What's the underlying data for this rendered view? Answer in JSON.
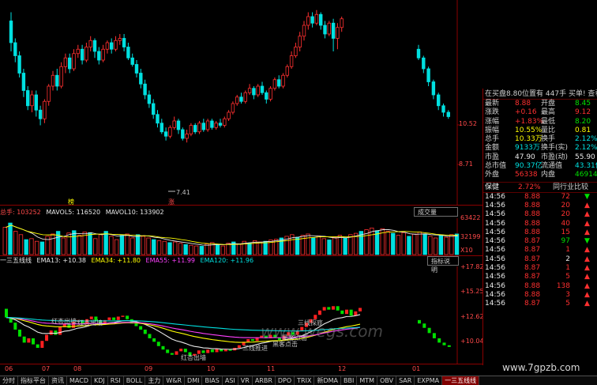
{
  "price_panel": {
    "y_labels": [
      "10.52",
      "8.71"
    ],
    "annotations": [
      {
        "text": "榜",
        "color": "#ffff00"
      },
      {
        "text": "7.41",
        "color": "#c0c0c0"
      },
      {
        "text": "涨",
        "color": "#ff4a4a"
      }
    ],
    "candles": [
      [
        13.0,
        12.0,
        13.4,
        11.6
      ],
      [
        12.0,
        11.4,
        12.2,
        11.1
      ],
      [
        11.4,
        10.6,
        11.6,
        10.4
      ],
      [
        10.6,
        9.8,
        10.8,
        9.5
      ],
      [
        9.8,
        9.1,
        10.0,
        8.9
      ],
      [
        9.1,
        9.6,
        9.8,
        8.8
      ],
      [
        9.6,
        8.9,
        9.8,
        8.6
      ],
      [
        8.9,
        8.5,
        9.1,
        8.2
      ],
      [
        8.5,
        9.3,
        9.4,
        8.3
      ],
      [
        9.3,
        10.0,
        10.1,
        9.1
      ],
      [
        10.0,
        10.5,
        10.7,
        9.8
      ],
      [
        10.5,
        10.0,
        10.8,
        9.8
      ],
      [
        10.0,
        10.9,
        11.1,
        9.9
      ],
      [
        10.9,
        11.3,
        11.5,
        10.6
      ],
      [
        11.3,
        10.8,
        11.5,
        10.6
      ],
      [
        10.8,
        11.5,
        11.7,
        10.7
      ],
      [
        11.5,
        11.7,
        11.9,
        11.3
      ],
      [
        11.7,
        11.2,
        11.9,
        11.0
      ],
      [
        11.2,
        11.8,
        12.0,
        11.1
      ],
      [
        11.8,
        12.1,
        12.3,
        11.6
      ],
      [
        12.1,
        11.6,
        12.2,
        11.3
      ],
      [
        11.6,
        11.2,
        11.8,
        11.0
      ],
      [
        11.2,
        11.7,
        11.9,
        11.1
      ],
      [
        11.7,
        12.0,
        12.1,
        11.5
      ],
      [
        12.0,
        11.7,
        12.2,
        11.5
      ],
      [
        11.7,
        12.1,
        12.3,
        11.6
      ],
      [
        12.1,
        12.2,
        12.4,
        11.9
      ],
      [
        12.2,
        11.8,
        12.4,
        11.6
      ],
      [
        11.8,
        11.3,
        12.0,
        11.2
      ],
      [
        11.3,
        11.0,
        11.5,
        10.9
      ],
      [
        11.0,
        10.6,
        11.2,
        10.4
      ],
      [
        10.6,
        10.1,
        10.8,
        9.9
      ],
      [
        10.1,
        9.6,
        10.3,
        9.4
      ],
      [
        9.6,
        9.2,
        9.8,
        9.0
      ],
      [
        9.2,
        8.7,
        9.4,
        8.5
      ],
      [
        8.7,
        8.3,
        8.9,
        8.1
      ],
      [
        8.3,
        7.9,
        8.5,
        7.8
      ],
      [
        7.9,
        7.7,
        8.1,
        7.5
      ],
      [
        7.7,
        8.1,
        8.2,
        7.6
      ],
      [
        8.1,
        8.4,
        8.6,
        8.0
      ],
      [
        8.4,
        8.0,
        8.5,
        7.8
      ],
      [
        8.0,
        7.6,
        8.1,
        7.5
      ],
      [
        7.6,
        7.8,
        8.0,
        7.41
      ],
      [
        7.8,
        8.2,
        8.3,
        7.7
      ],
      [
        8.2,
        7.9,
        8.3,
        7.8
      ],
      [
        7.9,
        8.3,
        8.4,
        7.8
      ],
      [
        8.3,
        8.0,
        8.5,
        7.9
      ],
      [
        8.0,
        8.4,
        8.5,
        7.9
      ],
      [
        8.4,
        8.1,
        8.5,
        8.0
      ],
      [
        8.1,
        8.3,
        8.4,
        8.0
      ],
      [
        8.3,
        8.2,
        8.5,
        8.1
      ],
      [
        8.2,
        8.5,
        8.6,
        8.1
      ],
      [
        8.5,
        8.8,
        8.9,
        8.4
      ],
      [
        8.8,
        9.2,
        9.3,
        8.7
      ],
      [
        9.2,
        9.5,
        9.6,
        9.1
      ],
      [
        9.5,
        9.3,
        9.7,
        9.2
      ],
      [
        9.3,
        9.7,
        9.8,
        9.2
      ],
      [
        9.7,
        9.9,
        10.1,
        9.6
      ],
      [
        9.9,
        9.6,
        10.0,
        9.4
      ],
      [
        9.6,
        10.0,
        10.1,
        9.5
      ],
      [
        10.0,
        9.7,
        10.2,
        9.6
      ],
      [
        9.7,
        9.4,
        9.8,
        9.2
      ],
      [
        9.4,
        9.9,
        10.0,
        9.3
      ],
      [
        9.9,
        10.3,
        10.4,
        9.8
      ],
      [
        10.3,
        10.0,
        10.5,
        9.9
      ],
      [
        10.0,
        10.5,
        10.6,
        9.9
      ],
      [
        10.5,
        10.9,
        11.0,
        10.4
      ],
      [
        10.9,
        11.4,
        11.6,
        10.8
      ],
      [
        11.4,
        11.8,
        12.0,
        11.3
      ],
      [
        11.8,
        12.3,
        12.5,
        11.6
      ],
      [
        12.3,
        12.8,
        13.0,
        12.1
      ],
      [
        12.8,
        13.2,
        13.4,
        12.6
      ],
      [
        13.2,
        12.9,
        13.4,
        12.7
      ],
      [
        12.9,
        13.3,
        13.5,
        12.8
      ],
      [
        13.3,
        12.8,
        13.4,
        12.6
      ],
      [
        12.8,
        12.4,
        13.0,
        12.2
      ],
      [
        12.4,
        12.9,
        13.0,
        12.3
      ],
      [
        12.9,
        12.2,
        13.1,
        11.6
      ],
      [
        12.2,
        12.7,
        12.9,
        11.7
      ],
      [
        12.7,
        13.1,
        13.2,
        12.5
      ]
    ],
    "candles2": [
      [
        11.7,
        11.3,
        11.9,
        11.2
      ],
      [
        11.3,
        10.8,
        11.4,
        10.6
      ],
      [
        10.8,
        10.2,
        10.9,
        10.0
      ],
      [
        10.2,
        9.6,
        10.3,
        9.4
      ],
      [
        9.6,
        9.1,
        9.7,
        8.9
      ],
      [
        9.1,
        8.8,
        9.2,
        8.6
      ],
      [
        8.8,
        8.6,
        8.9,
        8.5
      ]
    ]
  },
  "volume_panel": {
    "header": [
      {
        "text": "总手: 103252",
        "color": "#ff4a4a"
      },
      {
        "text": "MAVOL5: 116520",
        "color": "#e8e8e8"
      },
      {
        "text": "MAVOL10: 133902",
        "color": "#e8e8e8"
      }
    ],
    "tab_label": "成交量",
    "y_labels": [
      "63422",
      "32199",
      "X10"
    ],
    "bars": [
      82,
      95,
      70,
      60,
      45,
      48,
      40,
      38,
      55,
      62,
      70,
      50,
      65,
      72,
      58,
      68,
      66,
      48,
      60,
      70,
      55,
      45,
      58,
      62,
      50,
      60,
      55,
      50,
      45,
      42,
      40,
      36,
      38,
      34,
      30,
      28,
      26,
      25,
      32,
      36,
      30,
      26,
      34,
      38,
      32,
      40,
      35,
      42,
      38,
      40,
      44,
      46,
      50,
      55,
      60,
      52,
      58,
      62,
      50,
      56,
      48,
      44,
      52,
      58,
      50,
      60,
      64,
      70,
      75,
      80,
      72,
      78,
      70,
      64,
      58,
      66,
      55,
      62,
      68,
      60,
      55,
      50,
      58,
      52,
      60,
      62
    ]
  },
  "indicator_panel": {
    "header": [
      {
        "text": "一三五线线",
        "color": "#e8e8e8"
      },
      {
        "text": "EMA13: +10.38",
        "color": "#e8e8e8"
      },
      {
        "text": "EMA34: +11.80",
        "color": "#ffff00"
      },
      {
        "text": "EMA55: +11.99",
        "color": "#ff40ff"
      },
      {
        "text": "EMA120: +11.96",
        "color": "#00e0e0"
      }
    ],
    "tab_label": "指标说明",
    "y_labels": [
      "+17.82",
      "+15.25",
      "+12.62",
      "+10.04"
    ],
    "annotations": [
      {
        "text": "红杏出墙",
        "color": "#c0c0c0"
      },
      {
        "text": "红杏出墙",
        "color": "#c0c0c0"
      },
      {
        "text": "红杏出墙",
        "color": "#c0c0c0"
      },
      {
        "text": "三线推进",
        "color": "#c0c0c0"
      },
      {
        "text": "黑客点击",
        "color": "#c0c0c0"
      },
      {
        "text": "黑客点击",
        "color": "#c0c0c0"
      },
      {
        "text": "三线探底",
        "color": "#c0c0c0"
      }
    ]
  },
  "x_dates": [
    "06",
    "07",
    "08",
    "09",
    "10",
    "11",
    "12",
    "01"
  ],
  "quote_panel": {
    "header": "在买盘8.80位置有 447手 买单! 查看详细",
    "rows": [
      {
        "l1": "最新",
        "v1": "8.88",
        "l2": "开盘",
        "v2": "8.45",
        "c1": "#ff3030",
        "c2": "#00e000"
      },
      {
        "l1": "涨跌",
        "v1": "+0.16",
        "l2": "最高",
        "v2": "9.12",
        "c1": "#ff3030",
        "c2": "#ff3030"
      },
      {
        "l1": "涨幅",
        "v1": "+1.83%",
        "l2": "最低",
        "v2": "8.20",
        "c1": "#ff3030",
        "c2": "#00e000"
      },
      {
        "l1": "振幅",
        "v1": "10.55%",
        "l2": "量比",
        "v2": "0.81",
        "c1": "#ffff00",
        "c2": "#ffff00"
      },
      {
        "l1": "总手",
        "v1": "10.33万",
        "l2": "换手",
        "v2": "2.12%",
        "c1": "#ffff00",
        "c2": "#00e0e0"
      },
      {
        "l1": "金额",
        "v1": "9133万",
        "l2": "换手(实)",
        "v2": "2.12%",
        "c1": "#00e0e0",
        "c2": "#00e0e0"
      },
      {
        "l1": "市盈",
        "v1": "47.90",
        "l2": "市盈(动)",
        "v2": "55.90",
        "c1": "#e8e8e8",
        "c2": "#e8e8e8"
      },
      {
        "l1": "总市值",
        "v1": "90.37亿",
        "l2": "流通值",
        "v2": "43.31亿",
        "c1": "#00e0e0",
        "c2": "#00e0e0"
      },
      {
        "l1": "外盘",
        "v1": "56338",
        "l2": "内盘",
        "v2": "46914",
        "c1": "#ff3030",
        "c2": "#00e000"
      }
    ],
    "sector_label": "保健",
    "sector_change": "2.72%",
    "sector_btn": "同行业比较",
    "ticks": [
      {
        "time": "14:56",
        "price": "8.88",
        "vol": "72",
        "dir": "▼",
        "pc": "#ff3030",
        "vc": "#ff3030"
      },
      {
        "time": "14:56",
        "price": "8.88",
        "vol": "20",
        "dir": "▲",
        "pc": "#ff3030",
        "vc": "#ff3030"
      },
      {
        "time": "14:56",
        "price": "8.88",
        "vol": "20",
        "dir": "▲",
        "pc": "#ff3030",
        "vc": "#ff3030"
      },
      {
        "time": "14:56",
        "price": "8.88",
        "vol": "40",
        "dir": "▲",
        "pc": "#ff3030",
        "vc": "#ff3030"
      },
      {
        "time": "14:56",
        "price": "8.88",
        "vol": "15",
        "dir": "▲",
        "pc": "#ff3030",
        "vc": "#ff3030"
      },
      {
        "time": "14:56",
        "price": "8.87",
        "vol": "97",
        "dir": "▼",
        "pc": "#ff3030",
        "vc": "#00e000"
      },
      {
        "time": "14:56",
        "price": "8.87",
        "vol": "1",
        "dir": "▲",
        "pc": "#ff3030",
        "vc": "#ff3030"
      },
      {
        "time": "14:56",
        "price": "8.87",
        "vol": "2",
        "dir": "▲",
        "pc": "#ff3030",
        "vc": "#e8e8e8"
      },
      {
        "time": "14:56",
        "price": "8.87",
        "vol": "1",
        "dir": "▲",
        "pc": "#ff3030",
        "vc": "#ff3030"
      },
      {
        "time": "14:56",
        "price": "8.87",
        "vol": "5",
        "dir": "▲",
        "pc": "#ff3030",
        "vc": "#ff3030"
      },
      {
        "time": "14:56",
        "price": "8.88",
        "vol": "138",
        "dir": "▲",
        "pc": "#ff3030",
        "vc": "#ff3030"
      },
      {
        "time": "14:56",
        "price": "8.88",
        "vol": "3",
        "dir": "▲",
        "pc": "#ff3030",
        "vc": "#ff3030"
      },
      {
        "time": "14:56",
        "price": "8.87",
        "vol": "5",
        "dir": "▲",
        "pc": "#ff3030",
        "vc": "#ff3030"
      }
    ]
  },
  "bottom_tabs": [
    "分时",
    "指标平台",
    "资讯",
    "MACD",
    "KDJ",
    "RSI",
    "BOLL",
    "主力",
    "W&R",
    "DMI",
    "BIAS",
    "ASI",
    "VR",
    "ARBR",
    "DPO",
    "TRIX",
    "新DMA",
    "BBI",
    "MTM",
    "OBV",
    "SAR",
    "EXPMA",
    "一三五线线"
  ],
  "watermarks": [
    "www.wegs.com",
    "www.7gpzb.com"
  ]
}
